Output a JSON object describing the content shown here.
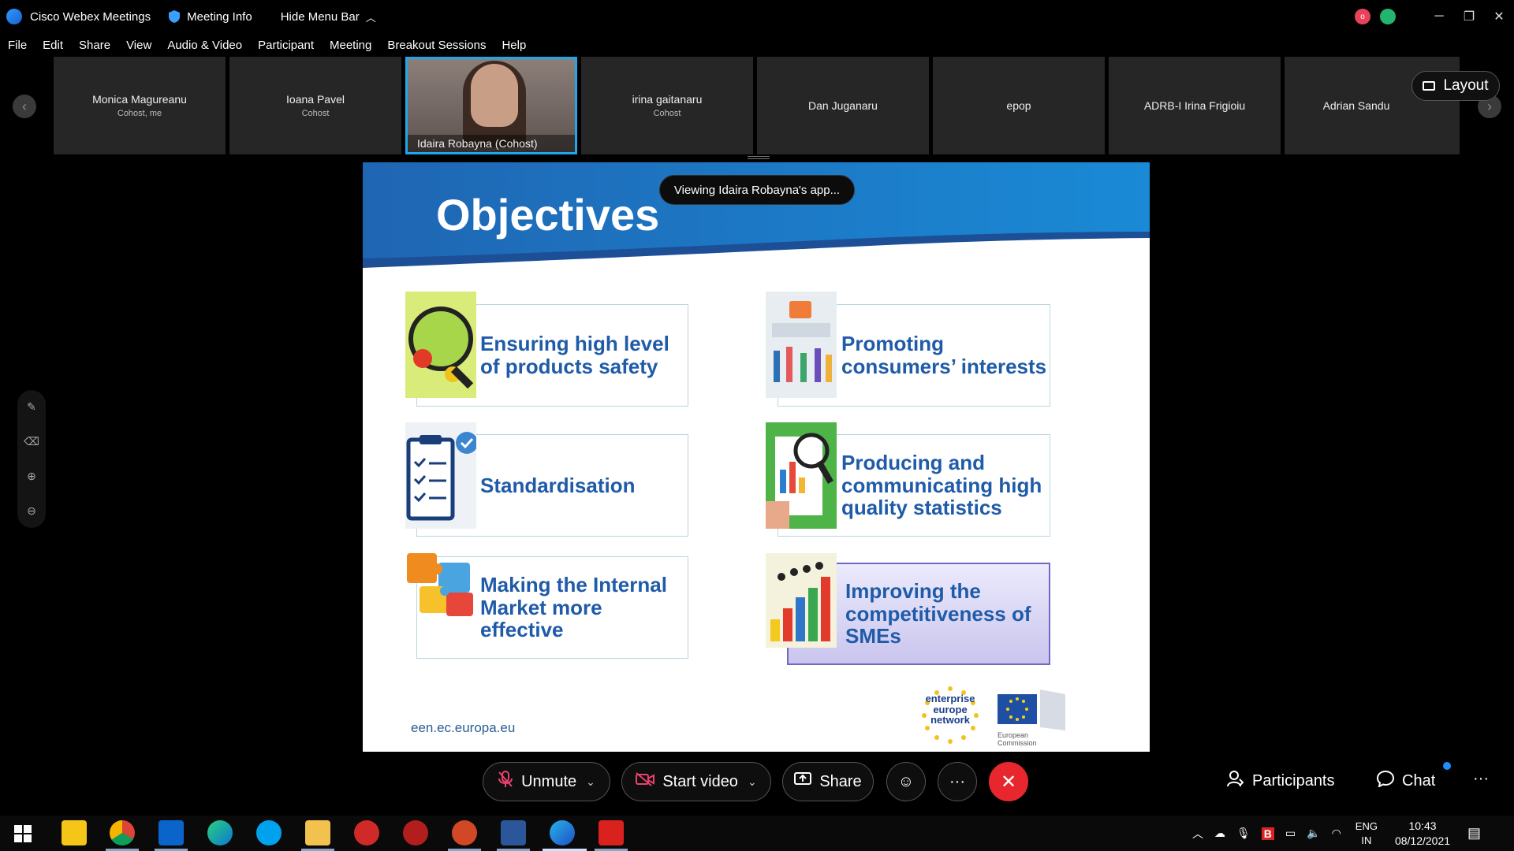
{
  "window": {
    "app_title": "Cisco Webex Meetings",
    "meeting_info": "Meeting Info",
    "hide_menu": "Hide Menu Bar",
    "rec_label": "o"
  },
  "menu": [
    "File",
    "Edit",
    "Share",
    "View",
    "Audio & Video",
    "Participant",
    "Meeting",
    "Breakout Sessions",
    "Help"
  ],
  "participants": [
    {
      "name": "Monica Magureanu",
      "role": "Cohost, me"
    },
    {
      "name": "Ioana Pavel",
      "role": "Cohost"
    },
    {
      "name": "Idaira Robayna (Cohost)",
      "role": ""
    },
    {
      "name": "irina gaitanaru",
      "role": "Cohost"
    },
    {
      "name": "Dan Juganaru",
      "role": ""
    },
    {
      "name": "epop",
      "role": ""
    },
    {
      "name": "ADRB-I Irina Frigioiu",
      "role": ""
    },
    {
      "name": "Adrian Sandu",
      "role": ""
    }
  ],
  "layout_label": "Layout",
  "toast": "Viewing Idaira Robayna's app...",
  "slide": {
    "title": "Objectives",
    "cards": [
      "Ensuring high level of products safety",
      "Promoting consumers’ interests",
      "Standardisation",
      "Producing and communicating high quality statistics",
      "Making the Internal Market more effective",
      "Improving the competitiveness of SMEs"
    ],
    "url": "een.ec.europa.eu",
    "een_logo": "enterprise europe network",
    "ec_logo": "European Commission"
  },
  "controls": {
    "unmute": "Unmute",
    "start_video": "Start video",
    "share": "Share",
    "participants": "Participants",
    "chat": "Chat"
  },
  "tray": {
    "lang": "ENG",
    "region": "IN",
    "time": "10:43",
    "date": "08/12/2021"
  },
  "colors": {
    "active_border": "#1ea7ea",
    "slide_blue": "#1f5ba8",
    "end_red": "#e8262e"
  }
}
